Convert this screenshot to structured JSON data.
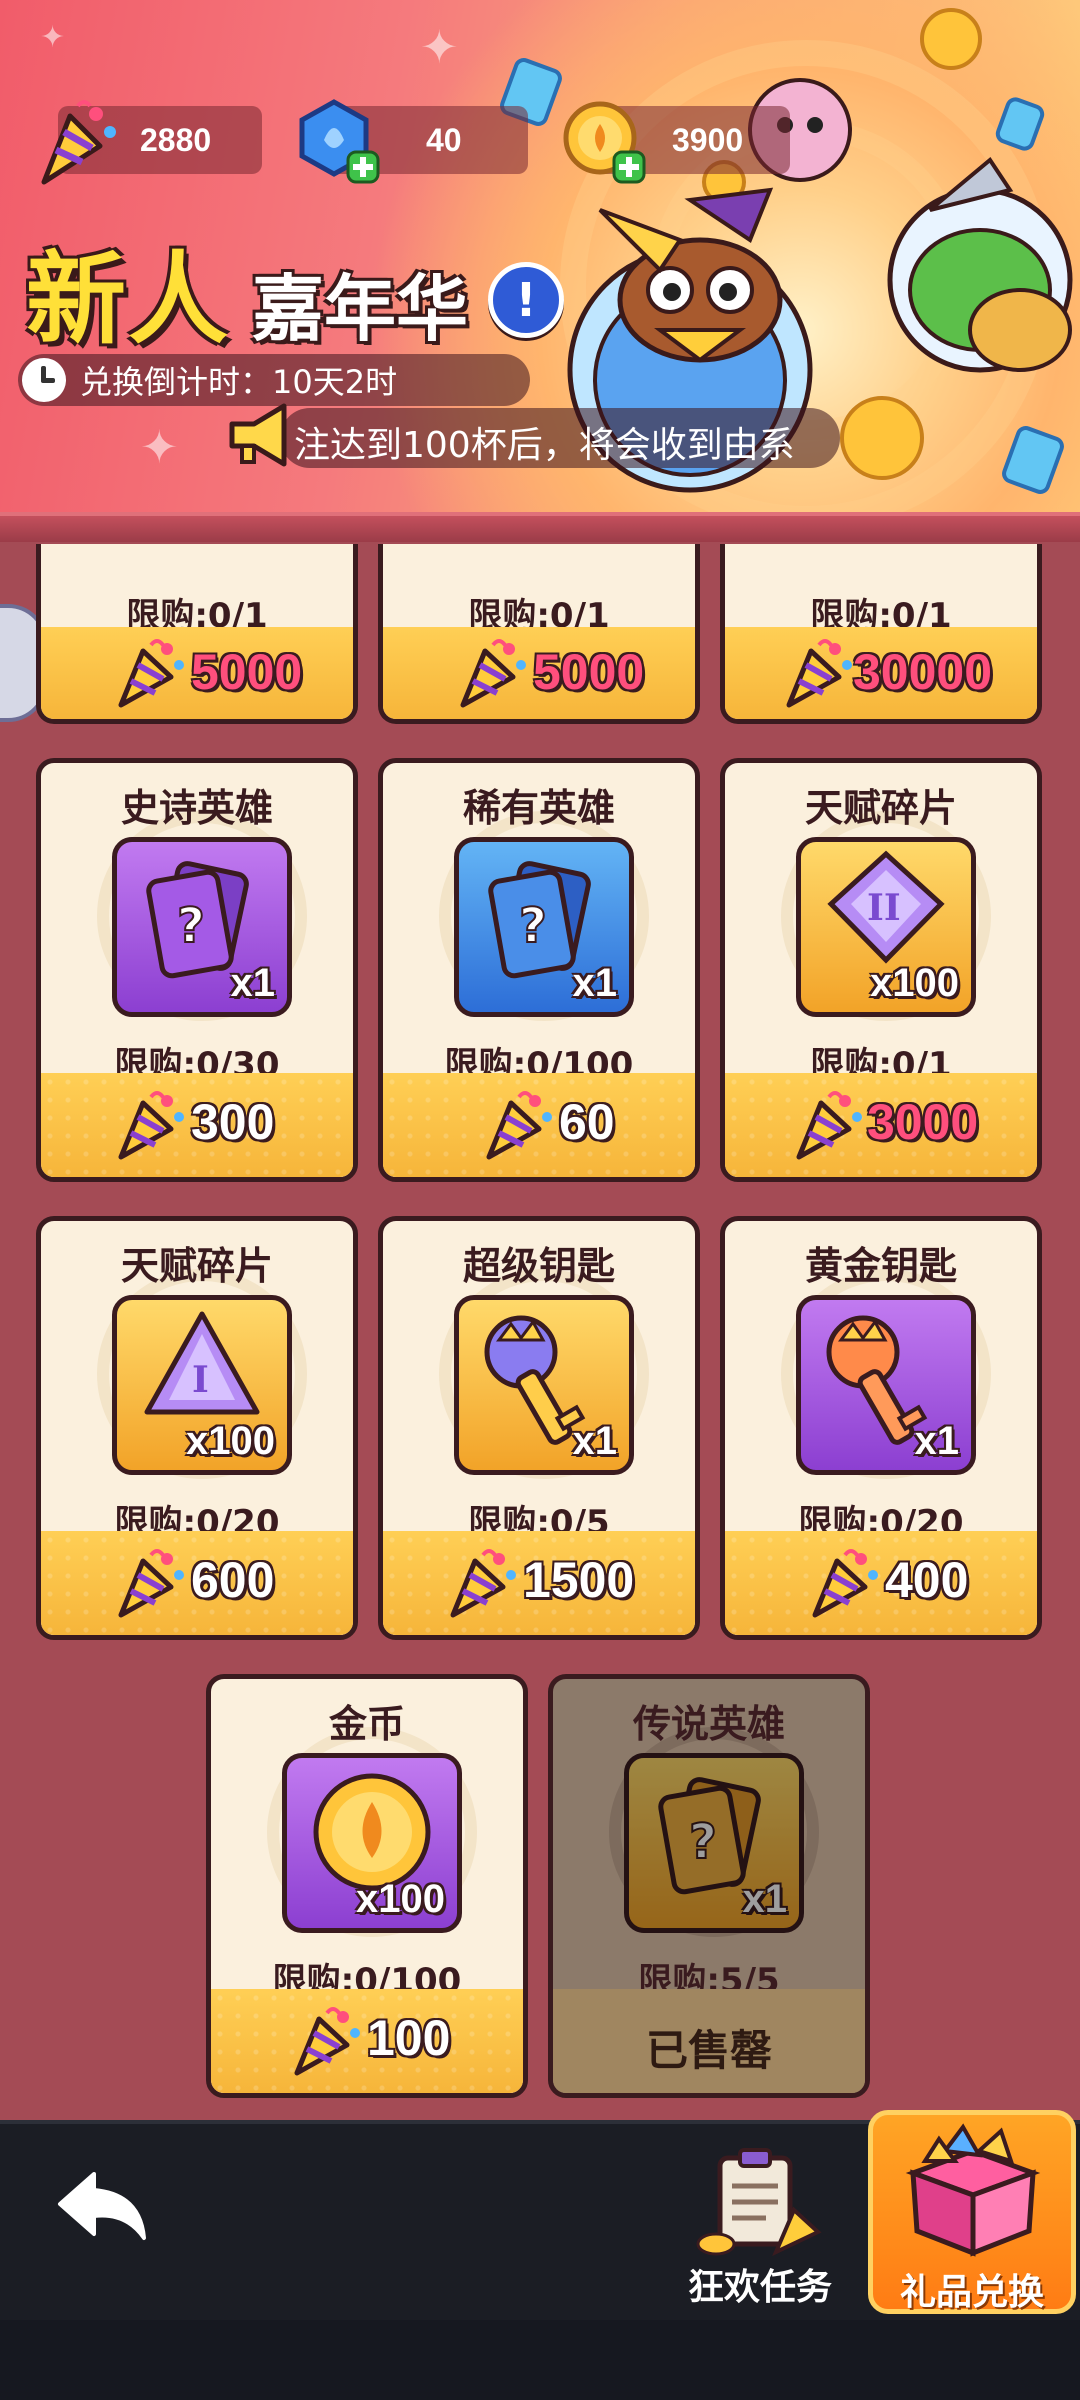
{
  "header": {
    "currencies": [
      {
        "name": "party-popper",
        "value": "2880"
      },
      {
        "name": "blue-gem",
        "value": "40"
      },
      {
        "name": "gold-coin",
        "value": "3900"
      }
    ],
    "title_main": "新人",
    "title_sub": "嘉年华",
    "info_icon": "!",
    "countdown": "兑换倒计时：10天2时",
    "marquee": "注达到100杯后，将会收到由系"
  },
  "top_row": [
    {
      "limit": "限购:0/1",
      "price": "5000",
      "price_color": "#ff4f7d"
    },
    {
      "limit": "限购:0/1",
      "price": "5000",
      "price_color": "#ff4f7d"
    },
    {
      "limit": "限购:0/1",
      "price": "30000",
      "price_color": "#ff4f7d"
    }
  ],
  "cards": [
    {
      "name": "史诗英雄",
      "icon": "purple-hero-card-icon",
      "qty": "x1",
      "limit": "限购:0/30",
      "price": "300",
      "price_color": "#ffffff"
    },
    {
      "name": "稀有英雄",
      "icon": "blue-hero-card-icon",
      "qty": "x1",
      "limit": "限购:0/100",
      "price": "60",
      "price_color": "#ffffff"
    },
    {
      "name": "天赋碎片",
      "icon": "talent-gem-ii-icon",
      "qty": "x100",
      "limit": "限购:0/1",
      "price": "3000",
      "price_color": "#ff4f7d"
    },
    {
      "name": "天赋碎片",
      "icon": "talent-gem-i-icon",
      "qty": "x100",
      "limit": "限购:0/20",
      "price": "600",
      "price_color": "#ffffff"
    },
    {
      "name": "超级钥匙",
      "icon": "super-key-icon",
      "qty": "x1",
      "limit": "限购:0/5",
      "price": "1500",
      "price_color": "#ffffff"
    },
    {
      "name": "黄金钥匙",
      "icon": "golden-key-icon",
      "qty": "x1",
      "limit": "限购:0/20",
      "price": "400",
      "price_color": "#ffffff"
    },
    {
      "name": "金币",
      "icon": "gold-coin-icon",
      "qty": "x100",
      "limit": "限购:0/100",
      "price": "100",
      "price_color": "#ffffff"
    },
    {
      "name": "传说英雄",
      "icon": "legend-hero-card-icon",
      "qty": "x1",
      "limit": "限购:5/5",
      "sold_out": "已售罄"
    }
  ],
  "bottom_nav": {
    "task_label": "狂欢任务",
    "gift_label": "礼品兑换"
  }
}
